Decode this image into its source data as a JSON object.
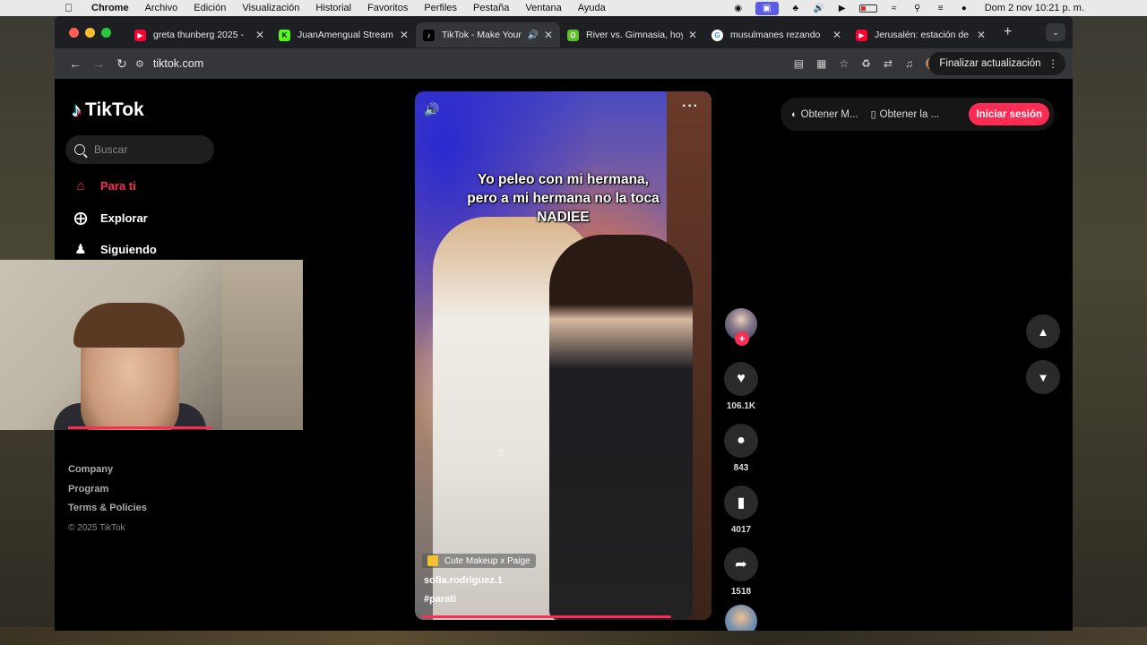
{
  "menubar": {
    "app": "Chrome",
    "items": [
      "Archivo",
      "Edición",
      "Visualización",
      "Historial",
      "Favoritos",
      "Perfiles",
      "Pestaña",
      "Ventana",
      "Ayuda"
    ],
    "clock": "Dom 2 nov  10:21 p. m."
  },
  "tabs": [
    {
      "title": "greta thunberg 2025 -",
      "favicon": "youtube"
    },
    {
      "title": "JuanAmengual Stream",
      "favicon": "kick"
    },
    {
      "title": "TikTok - Make Your",
      "favicon": "tiktok",
      "active": true
    },
    {
      "title": "River vs. Gimnasia, hoy",
      "favicon": "ole"
    },
    {
      "title": "musulmanes rezando",
      "favicon": "google"
    },
    {
      "title": "Jerusalén: estación de",
      "favicon": "youtube"
    }
  ],
  "toolbar": {
    "url": "tiktok.com",
    "update_button": "Finalizar actualización"
  },
  "sidebar": {
    "brand": "TikTok",
    "search_placeholder": "Buscar",
    "nav": [
      {
        "label": "Para ti",
        "icon": "home-icon",
        "active": true
      },
      {
        "label": "Explorar",
        "icon": "compass-icon"
      },
      {
        "label": "Siguiendo",
        "icon": "following-icon"
      }
    ],
    "footer": [
      "Company",
      "Program",
      "Terms & Policies"
    ],
    "copyright": "© 2025 TikTok"
  },
  "video": {
    "caption_lines": [
      "Yo peleo con mi hermana,",
      "pero a mi hermana no la toca",
      "NADIEE"
    ],
    "music": "Cute Makeup x Paige",
    "author": "sofia.rodriguez.1",
    "hashtag": "#parati"
  },
  "actions": {
    "likes": "106.1K",
    "comments": "843",
    "saves": "4017",
    "shares": "1518"
  },
  "header_right": {
    "get_app_1": "Obtener M...",
    "get_app_2": "Obtener la ...",
    "login": "Iniciar sesión"
  },
  "colors": {
    "accent": "#fe2c55",
    "page_bg": "#000000"
  }
}
